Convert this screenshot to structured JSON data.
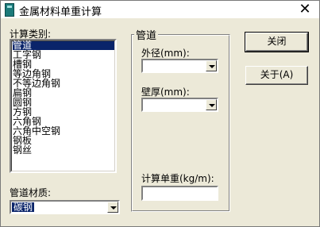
{
  "window": {
    "title": "金属材料单重计算",
    "close_glyph": "✕"
  },
  "left": {
    "type_label": "计算类别:",
    "types": [
      "管道",
      "工字钢",
      "槽钢",
      "等边角钢",
      "不等边角钢",
      "扁钢",
      "圆钢",
      "方钢",
      "六角钢",
      "六角中空钢",
      "钢板",
      "钢丝"
    ],
    "selected_index": 0,
    "material_label": "管道材质:",
    "material_value": "碳钢"
  },
  "group": {
    "title": "管道",
    "outer_diameter_label": "外径(mm):",
    "outer_diameter_value": "",
    "wall_thickness_label": "壁厚(mm):",
    "wall_thickness_value": "",
    "unit_weight_label": "计算单重(kg/m):",
    "unit_weight_value": ""
  },
  "buttons": {
    "close": "关闭",
    "about": "关于(A)"
  },
  "colors": {
    "selection": "#0a246a",
    "face": "#ece9d8"
  }
}
